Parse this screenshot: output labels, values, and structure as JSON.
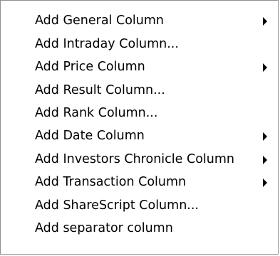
{
  "menu": {
    "items": [
      {
        "label": "Add General Column",
        "submenu": true
      },
      {
        "label": "Add Intraday Column...",
        "submenu": false
      },
      {
        "label": "Add Price Column",
        "submenu": true
      },
      {
        "label": "Add Result Column...",
        "submenu": false
      },
      {
        "label": "Add Rank Column...",
        "submenu": false
      },
      {
        "label": "Add Date Column",
        "submenu": true
      },
      {
        "label": "Add Investors Chronicle Column",
        "submenu": true
      },
      {
        "label": "Add Transaction Column",
        "submenu": true
      },
      {
        "label": "Add ShareScript Column...",
        "submenu": false
      },
      {
        "label": "Add separator column",
        "submenu": false
      }
    ]
  }
}
